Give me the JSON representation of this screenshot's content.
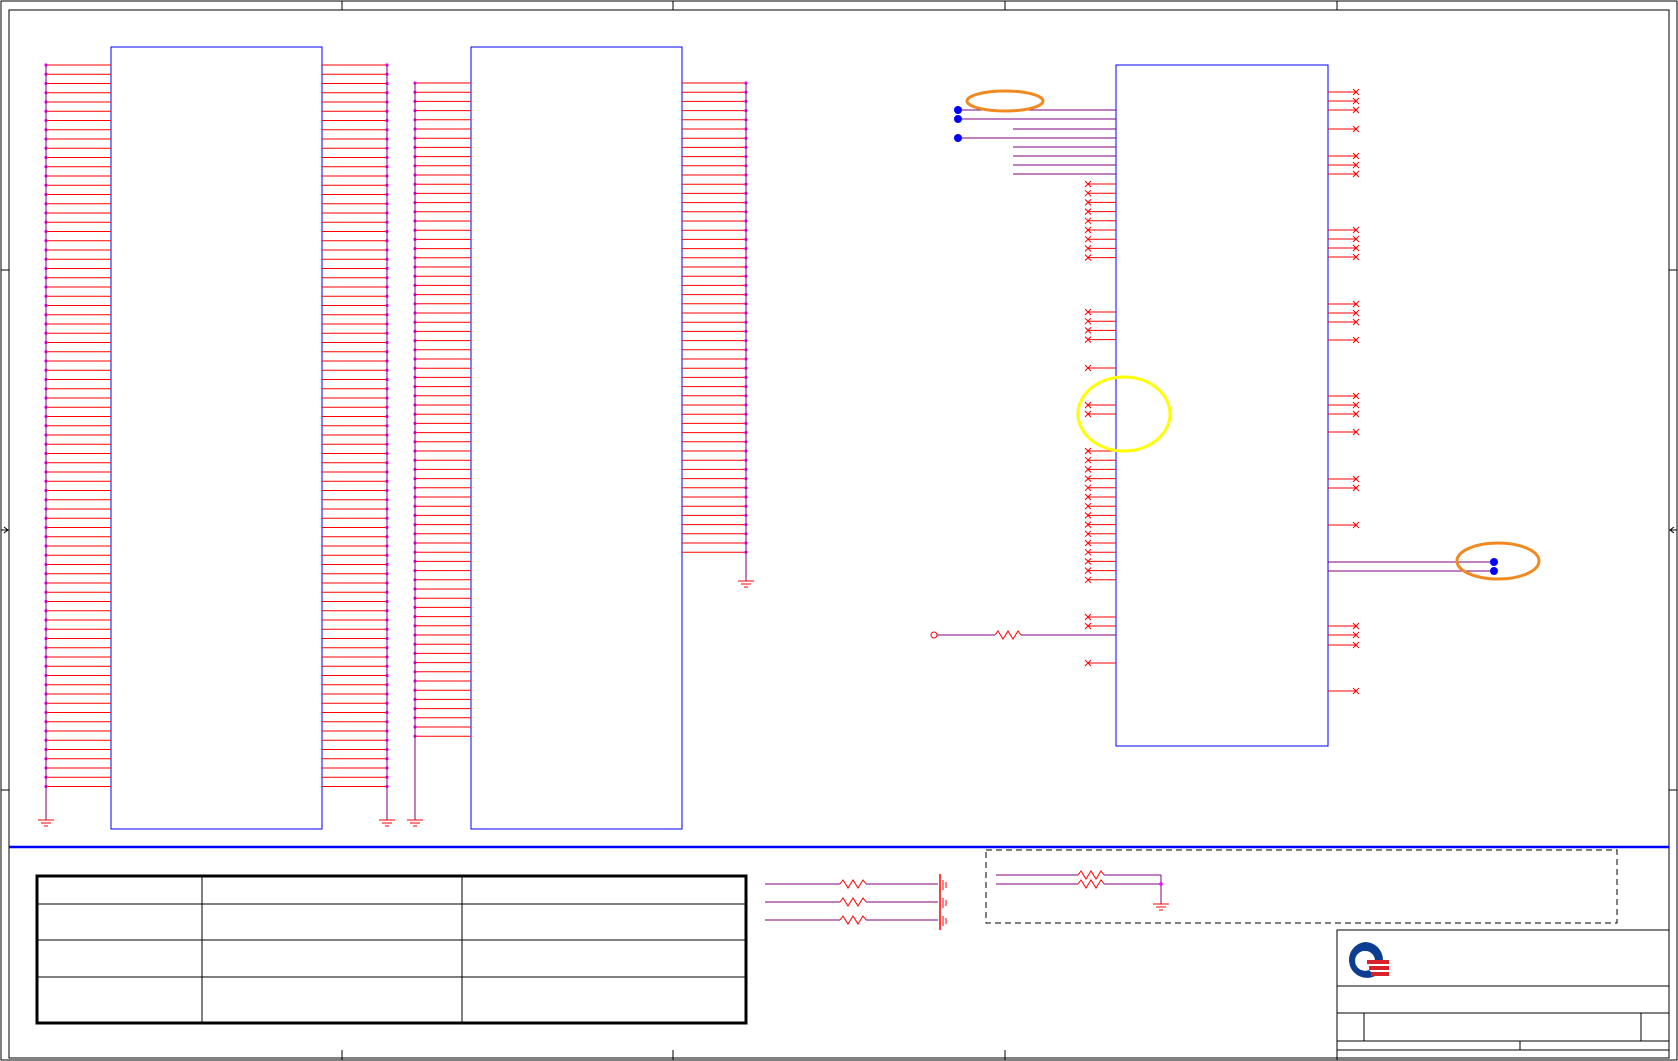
{
  "document": {
    "type": "schematic-sheet",
    "title_block": {
      "company_logo": "quanta-q-logo"
    },
    "revision_table": {
      "rows": 4,
      "columns": 3,
      "cells": [
        [
          "",
          "",
          ""
        ],
        [
          "",
          "",
          ""
        ],
        [
          "",
          "",
          ""
        ],
        [
          "",
          "",
          ""
        ]
      ]
    }
  },
  "colors": {
    "frame": "#000000",
    "component_outline": "#0000ff",
    "pin_wire": "#ff0000",
    "net_wire": "#800080",
    "pin_dot": "#ff00ff",
    "highlight_orange": "#f0891f",
    "highlight_yellow": "#ffff00",
    "logo_blue": "#0b3d91",
    "logo_red": "#d8232a"
  },
  "components": [
    {
      "ref": "connector-left-1",
      "kind": "connector"
    },
    {
      "ref": "connector-left-2",
      "kind": "connector"
    },
    {
      "ref": "ic-right",
      "kind": "integrated-circuit"
    }
  ],
  "icons": [
    "ground-icon",
    "resistor-icon",
    "capacitor-icon",
    "no-connect-icon",
    "test-point-icon",
    "junction-dot-icon"
  ]
}
